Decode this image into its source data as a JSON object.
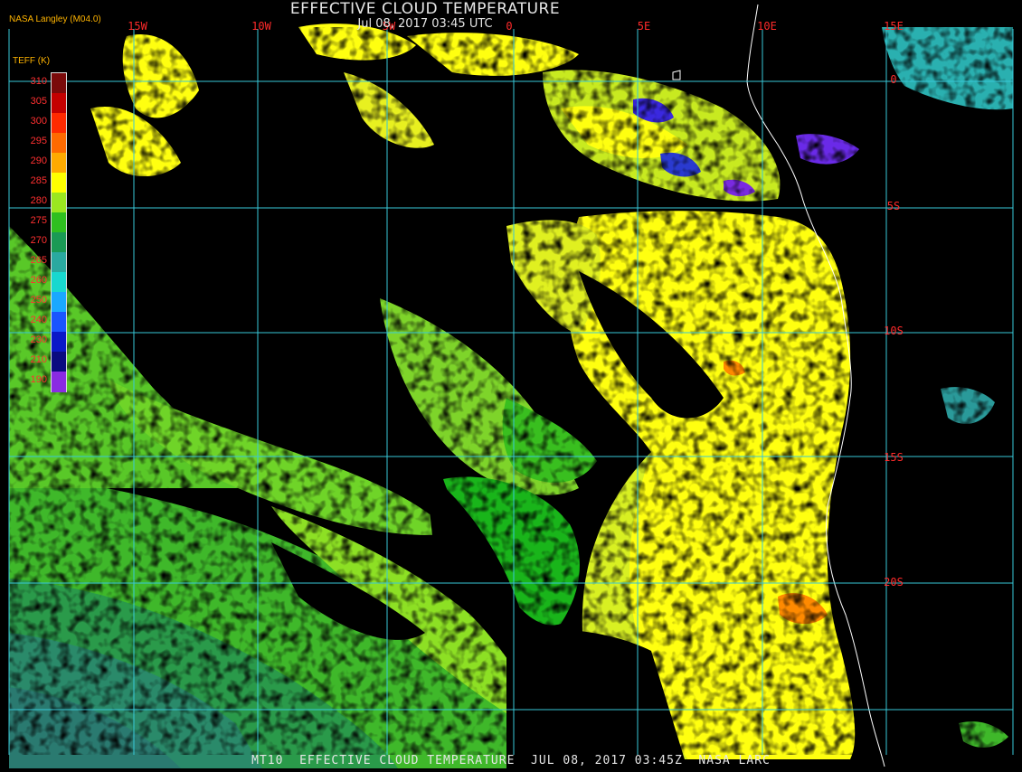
{
  "header": {
    "title": "EFFECTIVE CLOUD TEMPERATURE",
    "subtitle": "Jul 08, 2017 03:45 UTC",
    "source": "NASA Langley (M04.0)"
  },
  "legend": {
    "title": "TEFF (K)",
    "stops": [
      {
        "label": "310",
        "color": "#7a0a0a"
      },
      {
        "label": "305",
        "color": "#c40000"
      },
      {
        "label": "300",
        "color": "#ff2a00"
      },
      {
        "label": "295",
        "color": "#ff6a00"
      },
      {
        "label": "290",
        "color": "#ffaa00"
      },
      {
        "label": "285",
        "color": "#ffff00"
      },
      {
        "label": "280",
        "color": "#9be61f"
      },
      {
        "label": "275",
        "color": "#2fbf1f"
      },
      {
        "label": "270",
        "color": "#1a9a55"
      },
      {
        "label": "265",
        "color": "#2aa9a0"
      },
      {
        "label": "260",
        "color": "#18d8cf"
      },
      {
        "label": "250",
        "color": "#1aa8ff"
      },
      {
        "label": "240",
        "color": "#1a55ff"
      },
      {
        "label": "230",
        "color": "#0a18c8"
      },
      {
        "label": "210",
        "color": "#0a0a80"
      },
      {
        "label": "190",
        "color": "#8a2be2"
      }
    ]
  },
  "map": {
    "longitude_labels": [
      "15W",
      "10W",
      "5W",
      "0",
      "5E",
      "10E",
      "15E"
    ],
    "latitude_labels": [
      "0",
      "5S",
      "10S",
      "15S",
      "20S"
    ],
    "colors": {
      "grid": "#38c8d8",
      "coast": "#ffffff",
      "background": "#000000"
    }
  },
  "footer": {
    "text": "MT10  EFFECTIVE CLOUD TEMPERATURE  JUL 08, 2017 03:45Z  NASA LARC"
  }
}
